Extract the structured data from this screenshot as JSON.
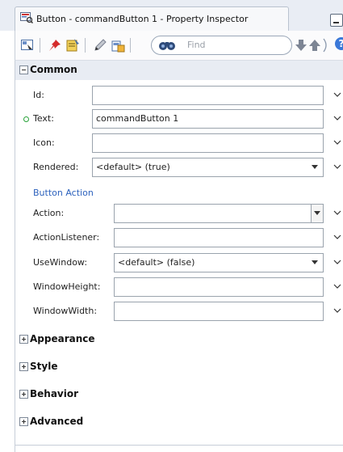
{
  "window": {
    "title": "Button - commandButton 1 - Property Inspector"
  },
  "toolbar": {
    "find_placeholder": "Find",
    "help_label": "?"
  },
  "sections": {
    "common": "Common",
    "appearance": "Appearance",
    "style": "Style",
    "behavior": "Behavior",
    "advanced": "Advanced"
  },
  "common": {
    "id_label": "Id:",
    "id_value": "",
    "text_label": "Text:",
    "text_value": "commandButton 1",
    "icon_label": "Icon:",
    "icon_value": "",
    "rendered_label": "Rendered:",
    "rendered_value": "<default> (true)"
  },
  "button_action": {
    "heading": "Button Action",
    "action_label": "Action:",
    "action_value": "",
    "actionlistener_label": "ActionListener:",
    "actionlistener_value": "",
    "usewindow_label": "UseWindow:",
    "usewindow_value": "<default> (false)",
    "windowheight_label": "WindowHeight:",
    "windowheight_value": "",
    "windowwidth_label": "WindowWidth:",
    "windowwidth_value": ""
  },
  "icons": [
    "property-inspector-icon",
    "select-icon",
    "pin-icon",
    "edit-icon",
    "pencil-icon",
    "bind-icon",
    "binoculars-icon",
    "find-down-icon",
    "find-up-icon",
    "help-icon",
    "minimize-icon",
    "chevron-down-icon"
  ],
  "colors": {
    "accent": "#2d62bd",
    "set_indicator": "#29a33a",
    "header_bg": "#e8ecf3"
  }
}
